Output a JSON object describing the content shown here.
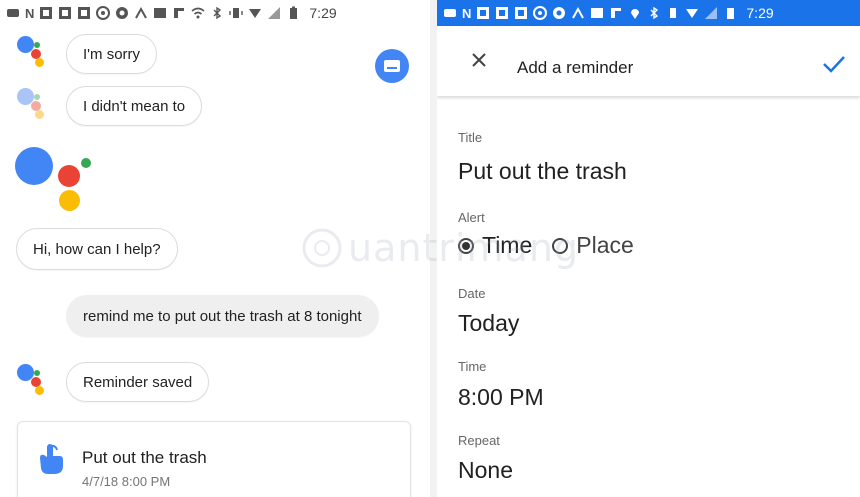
{
  "left": {
    "status_time": "7:29",
    "messages": [
      {
        "role": "assistant",
        "text": "I'm sorry"
      },
      {
        "role": "assistant",
        "text": "I didn't mean to"
      },
      {
        "role": "assistant",
        "text": "Hi, how can I help?"
      },
      {
        "role": "user",
        "text": "remind me to put out the trash at 8 tonight"
      },
      {
        "role": "assistant",
        "text": "Reminder saved"
      }
    ],
    "card": {
      "title": "Put out the trash",
      "subtitle": "4/7/18 8:00 PM",
      "icon": "reminder-hand-icon"
    },
    "keyboard_icon": "keyboard-icon"
  },
  "right": {
    "status_time": "7:29",
    "appbar": {
      "title": "Add a reminder",
      "close_icon": "close-icon",
      "confirm_icon": "check-icon"
    },
    "fields": {
      "title": {
        "label": "Title",
        "value": "Put out the trash"
      },
      "alert": {
        "label": "Alert",
        "options": [
          "Time",
          "Place"
        ],
        "selected": "Time"
      },
      "date": {
        "label": "Date",
        "value": "Today"
      },
      "time": {
        "label": "Time",
        "value": "8:00 PM"
      },
      "repeat": {
        "label": "Repeat",
        "value": "None"
      }
    }
  },
  "watermark": {
    "text": "uantrimang"
  },
  "colors": {
    "accent": "#4285f4",
    "status_bar_right": "#1a73e8",
    "user_bubble": "#efefef",
    "google_blue": "#4285f4",
    "google_red": "#ea4335",
    "google_yellow": "#fbbc05",
    "google_green": "#34a853"
  }
}
